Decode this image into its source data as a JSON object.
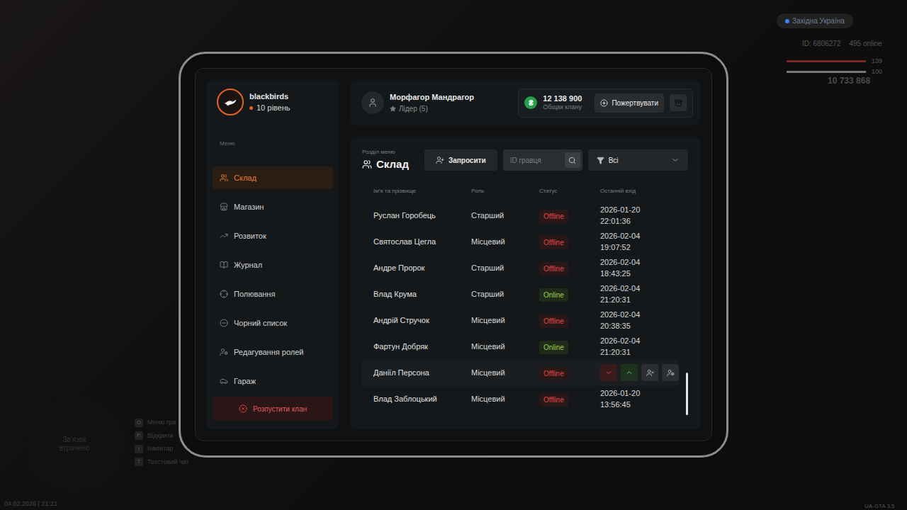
{
  "clan": {
    "name": "blackbirds",
    "level": "10 рівень"
  },
  "sidebar": {
    "menu_label": "Меню",
    "items": [
      {
        "label": "Склад",
        "icon": "users",
        "selected": true
      },
      {
        "label": "Магазин",
        "icon": "store",
        "selected": false
      },
      {
        "label": "Розвиток",
        "icon": "trend",
        "selected": false
      },
      {
        "label": "Журнал",
        "icon": "book",
        "selected": false
      },
      {
        "label": "Полювання",
        "icon": "hunt",
        "selected": false
      },
      {
        "label": "Чорний список",
        "icon": "minus",
        "selected": false
      },
      {
        "label": "Редагування ролей",
        "icon": "roles",
        "selected": false
      },
      {
        "label": "Гараж",
        "icon": "car",
        "selected": false
      }
    ],
    "dissolve_button": "Розпустити клан"
  },
  "header": {
    "user_name": "Морфагор Мандрагор",
    "user_role": "Лідер (5)",
    "currency_icon": "₴",
    "balance": "12 138 900",
    "balance_label": "Общак клану",
    "donate_button": "Пожертвувати"
  },
  "section": {
    "label": "Розділ меню",
    "title": "Склад",
    "invite_button": "Запросити",
    "search_placeholder": "ID гравця",
    "filter": "Всі"
  },
  "table": {
    "columns": [
      "Ім'я та прізвище",
      "Роль",
      "Статус",
      "Останній вхід"
    ],
    "rows": [
      {
        "name": "Руслан Горобець",
        "role": "Старший",
        "status": "Offline",
        "online": false,
        "last_login": "2026-01-20 22:01:36",
        "hovered": false
      },
      {
        "name": "Святослав Цегла",
        "role": "Місцевий",
        "status": "Offline",
        "online": false,
        "last_login": "2026-02-04 19:07:52",
        "hovered": false
      },
      {
        "name": "Андре Пророк",
        "role": "Старший",
        "status": "Offline",
        "online": false,
        "last_login": "2026-02-04 18:43:25",
        "hovered": false
      },
      {
        "name": "Влад Крума",
        "role": "Старший",
        "status": "Online",
        "online": true,
        "last_login": "2026-02-04 21:20:31",
        "hovered": false
      },
      {
        "name": "Андрій Стручок",
        "role": "Місцевий",
        "status": "Offline",
        "online": false,
        "last_login": "2026-02-04 20:38:35",
        "hovered": false
      },
      {
        "name": "Фартун Добряк",
        "role": "Місцевий",
        "status": "Online",
        "online": true,
        "last_login": "2026-02-04 21:20:31",
        "hovered": false
      },
      {
        "name": "Даніїл Персона",
        "role": "Місцевий",
        "status": "Offline",
        "online": false,
        "last_login": "",
        "hovered": true
      },
      {
        "name": "Влад Заблоцький",
        "role": "Місцевий",
        "status": "Offline",
        "online": false,
        "last_login": "2026-01-20 13:56:45",
        "hovered": false
      }
    ]
  },
  "hud": {
    "region": "Західна Україна",
    "player_id": "ID: 6806272",
    "online": "495 online",
    "health": "139",
    "health_level": 1,
    "armor": "100",
    "armor_level": 1,
    "money": "10 733 868",
    "minimap_text": "Зв'язок втрачено",
    "hints": [
      {
        "key": "O",
        "label": "Меню гра"
      },
      {
        "key": "P",
        "label": "Відкрити"
      },
      {
        "key": "I",
        "label": "Інвентар"
      },
      {
        "key": "T",
        "label": "Текстовий чат"
      }
    ],
    "datetime": "04.02.2026 | 21:21",
    "version": "UA-GTA 3.5"
  }
}
